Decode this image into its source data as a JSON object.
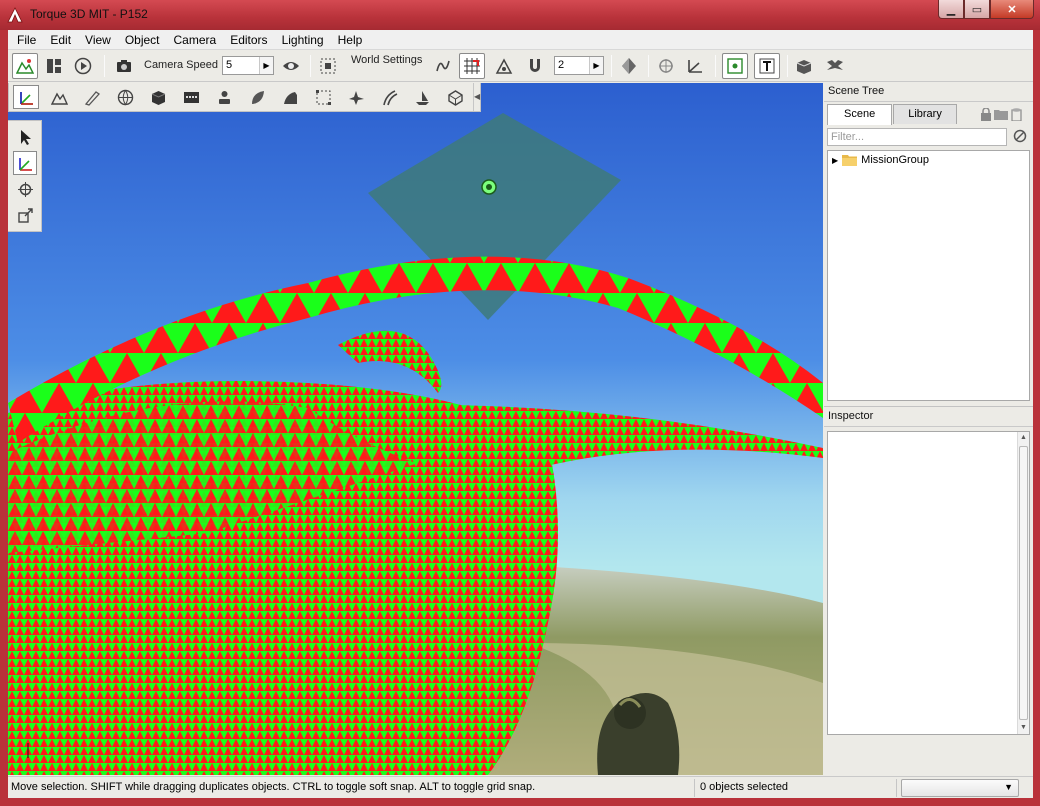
{
  "window": {
    "title": "Torque 3D MIT - P152"
  },
  "menu": [
    "File",
    "Edit",
    "View",
    "Object",
    "Camera",
    "Editors",
    "Lighting",
    "Help"
  ],
  "toolbar": {
    "camera_speed_label": "Camera Speed",
    "camera_speed_value": "5",
    "world_settings_label": "World Settings",
    "grid_value": "2"
  },
  "scene_tree": {
    "title": "Scene Tree",
    "tabs": [
      "Scene",
      "Library"
    ],
    "active_tab": "Scene",
    "filter_placeholder": "Filter...",
    "root_item": "MissionGroup"
  },
  "inspector": {
    "title": "Inspector"
  },
  "status": {
    "message": "Move selection.  SHIFT while dragging duplicates objects.  CTRL to toggle soft snap.  ALT to toggle grid snap.",
    "selection_count": "0 objects selected"
  },
  "icons": {
    "app": "torque-logo-icon",
    "folder": "folder-icon",
    "lock": "lock-icon",
    "new-folder": "new-folder-icon",
    "delete": "trash-icon",
    "clear-filter": "clear-filter-icon"
  },
  "colors": {
    "mesh_red": "#ff1a1a",
    "mesh_green": "#1aff1a",
    "sky_top": "#2c5fcf",
    "sky_bottom": "#b3e7ee",
    "titlebar": "#b8323a"
  }
}
